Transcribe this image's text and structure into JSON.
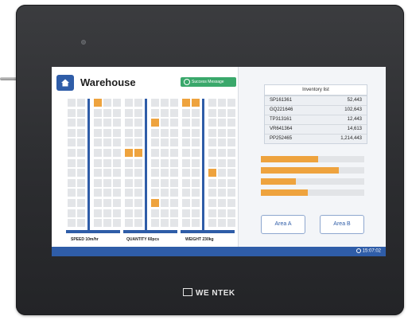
{
  "device": {
    "brand": "WE NTEK"
  },
  "header": {
    "title": "Warehouse",
    "status_message": "Success Message"
  },
  "grids": [
    {
      "label": "SPEED  10m/hr",
      "highlights": [
        [
          6,
          2
        ],
        [
          19,
          0
        ],
        [
          19,
          2
        ]
      ]
    },
    {
      "label": "QUANTITY  60pcs",
      "highlights": [
        [
          11,
          0
        ],
        [
          8,
          2
        ],
        [
          16,
          2
        ]
      ]
    },
    {
      "label": "WEIGHT  230kg",
      "highlights": [
        [
          6,
          0
        ],
        [
          13,
          2
        ],
        [
          19,
          0
        ]
      ]
    }
  ],
  "inventory": {
    "header": "Inventory list",
    "rows": [
      {
        "id": "SP161361",
        "qty": "52,443"
      },
      {
        "id": "GQ221646",
        "qty": "102,643"
      },
      {
        "id": "TP313161",
        "qty": "12,443"
      },
      {
        "id": "VR641364",
        "qty": "14,613"
      },
      {
        "id": "PP252465",
        "qty": "1,214,443"
      }
    ]
  },
  "progress": [
    0.55,
    0.75,
    0.34,
    0.45
  ],
  "buttons": {
    "area_a": "Area A",
    "area_b": "Area B"
  },
  "footer": {
    "time": "15:07:02"
  },
  "colors": {
    "accent": "#2f5da8",
    "highlight": "#eea33e",
    "success": "#3aa86b"
  }
}
